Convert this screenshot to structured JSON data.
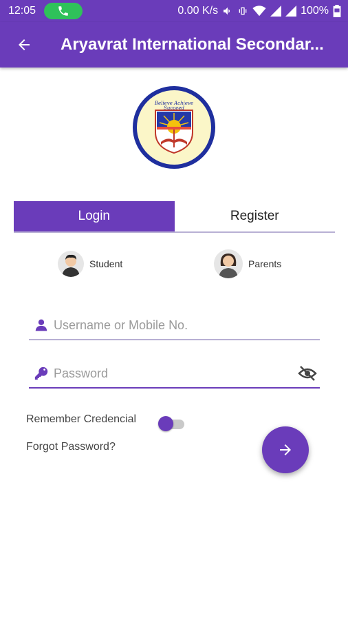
{
  "status_bar": {
    "time": "12:05",
    "net_speed": "0.00 K/s",
    "battery": "100%",
    "icons": [
      "call-icon",
      "volume-icon",
      "vibrate-icon",
      "wifi-icon",
      "signal-icon",
      "signal-icon",
      "battery-icon"
    ]
  },
  "app_bar": {
    "title": "Aryavrat International Secondar...",
    "back_icon": "arrow-back-icon"
  },
  "logo": {
    "motto": "Believe Achieve Succeed"
  },
  "tabs": [
    {
      "label": "Login",
      "active": true
    },
    {
      "label": "Register",
      "active": false
    }
  ],
  "roles": {
    "student": "Student",
    "parents": "Parents"
  },
  "form": {
    "username_placeholder": "Username or Mobile No.",
    "username_value": "",
    "password_placeholder": "Password",
    "password_value": "",
    "remember_label": "Remember Credencial",
    "remember_on": true,
    "forgot_label": "Forgot Password?"
  },
  "colors": {
    "primary": "#6a3cba",
    "call_badge": "#2fc15a",
    "divider": "#b8b0d4"
  }
}
